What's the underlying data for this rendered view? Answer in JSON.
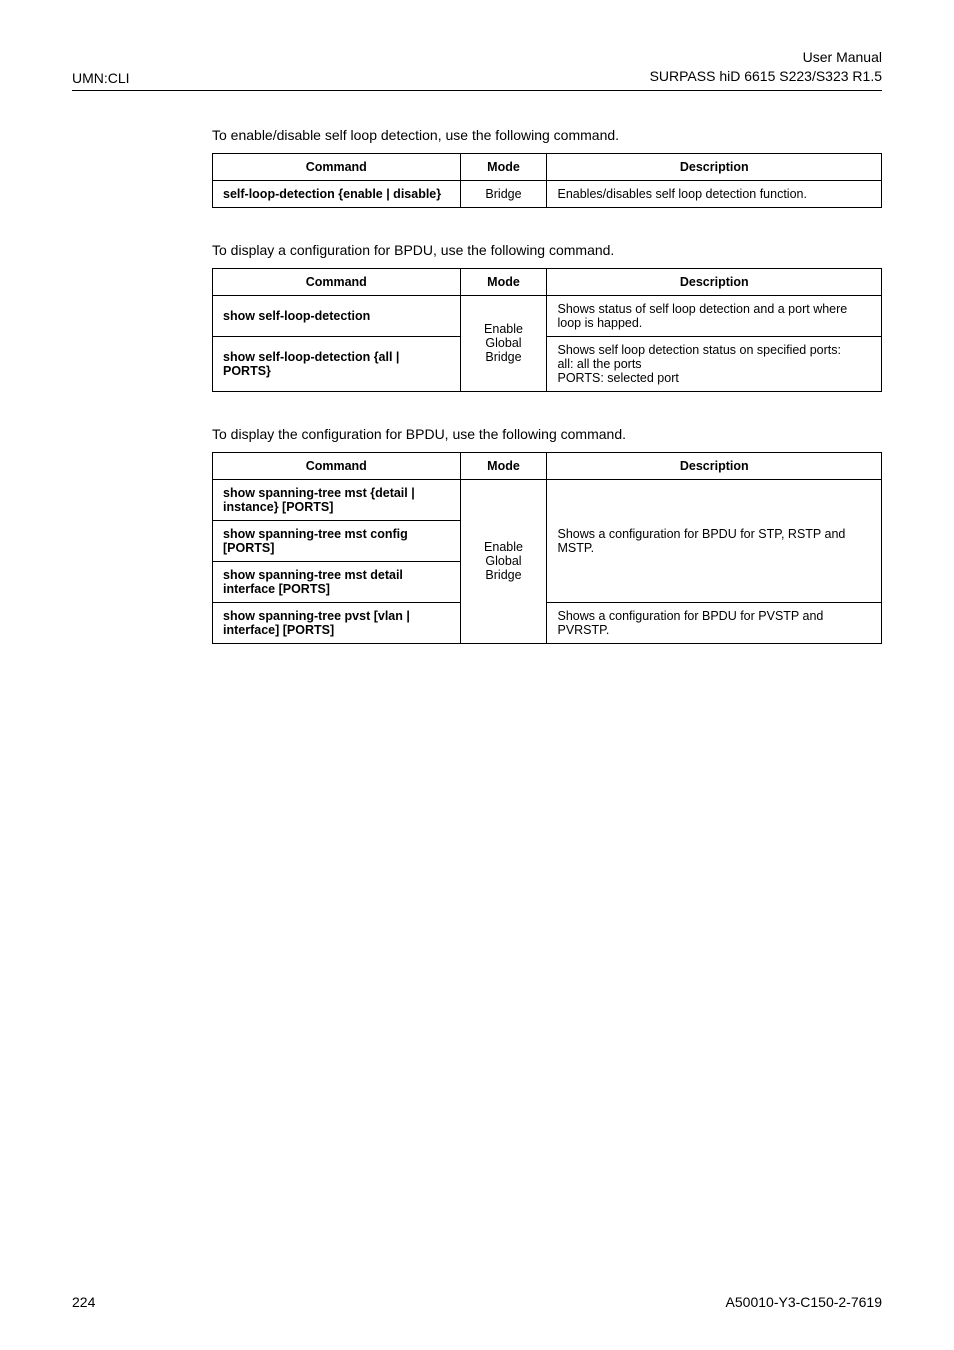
{
  "header": {
    "left": "UMN:CLI",
    "right1": "User Manual",
    "right2": "SURPASS hiD 6615 S223/S323 R1.5"
  },
  "para1": "To enable/disable self loop detection, use the following command.",
  "table1": {
    "headers": {
      "cmd": "Command",
      "mode": "Mode",
      "desc": "Description"
    },
    "rows": [
      {
        "cmd": "self-loop-detection {enable | disable}",
        "mode": "Bridge",
        "desc": "Enables/disables self loop detection function."
      }
    ]
  },
  "para2": "To display a configuration for BPDU, use the following command.",
  "table2": {
    "headers": {
      "cmd": "Command",
      "mode": "Mode",
      "desc": "Description"
    },
    "mode_shared": "Enable\nGlobal\nBridge",
    "rows": [
      {
        "cmd": "show self-loop-detection",
        "desc": "Shows status of self loop detection and a port where loop is happed."
      },
      {
        "cmd": "show self-loop-detection {all | PORTS}",
        "desc_l1": "Shows self loop detection status on specified ports:",
        "desc_l2": "all: all the ports",
        "desc_l3": "PORTS: selected port"
      }
    ]
  },
  "para3": "To display the configuration for BPDU, use the following command.",
  "table3": {
    "headers": {
      "cmd": "Command",
      "mode": "Mode",
      "desc": "Description"
    },
    "mode_shared": "Enable\nGlobal\nBridge",
    "rows": [
      {
        "cmd": "show spanning-tree mst {detail | instance} [PORTS]"
      },
      {
        "cmd": "show spanning-tree mst config [PORTS]"
      },
      {
        "cmd": "show spanning-tree mst detail interface [PORTS]"
      },
      {
        "cmd": "show spanning-tree pvst [vlan | interface] [PORTS]"
      }
    ],
    "desc1": "Shows a configuration for BPDU for STP, RSTP and MSTP.",
    "desc2": "Shows a configuration for BPDU for PVSTP and PVRSTP."
  },
  "footer": {
    "left": "224",
    "right": "A50010-Y3-C150-2-7619"
  }
}
